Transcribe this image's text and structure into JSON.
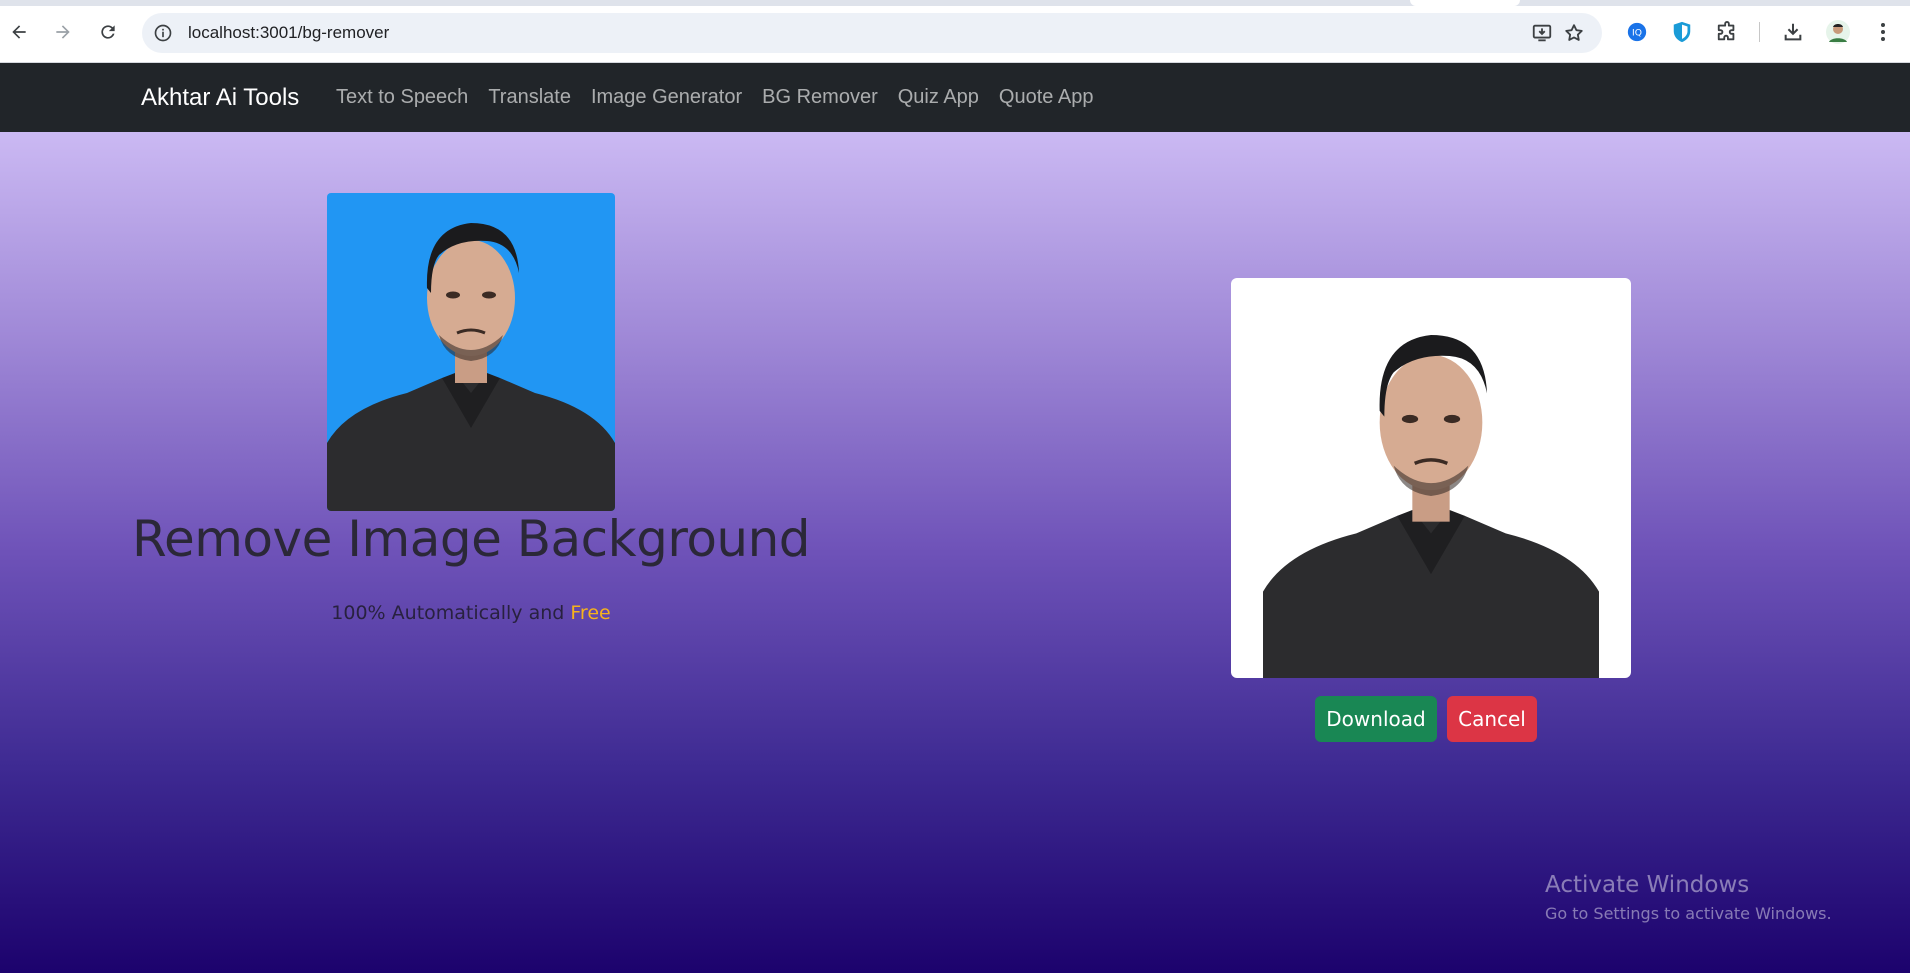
{
  "browser": {
    "url": "localhost:3001/bg-remover",
    "icons": [
      "back-arrow-icon",
      "forward-arrow-icon",
      "reload-icon",
      "site-info-icon",
      "install-app-icon",
      "bookmark-star-icon",
      "extension-blue-icon",
      "shield-extension-icon",
      "puzzle-icon",
      "download-icon",
      "profile-avatar",
      "kebab-menu-icon"
    ]
  },
  "navbar": {
    "brand": "Akhtar Ai Tools",
    "links": [
      {
        "label": "Text to Speech"
      },
      {
        "label": "Translate"
      },
      {
        "label": "Image Generator"
      },
      {
        "label": "BG Remover"
      },
      {
        "label": "Quiz App"
      },
      {
        "label": "Quote App"
      }
    ]
  },
  "hero": {
    "title": "Remove Image Background",
    "subtitle_prefix": "100% Automatically and ",
    "subtitle_accent": "Free"
  },
  "actions": {
    "download_label": "Download",
    "cancel_label": "Cancel"
  },
  "watermark": {
    "title": "Activate Windows",
    "subtitle": "Go to Settings to activate Windows."
  },
  "colors": {
    "navbar_bg": "#212529",
    "original_photo_bg": "#2196f3",
    "accent_free": "#f6b21c",
    "download_btn": "#198754",
    "cancel_btn": "#dc3545",
    "gradient_top": "#cbb9f3",
    "gradient_bottom": "#1c026d"
  }
}
